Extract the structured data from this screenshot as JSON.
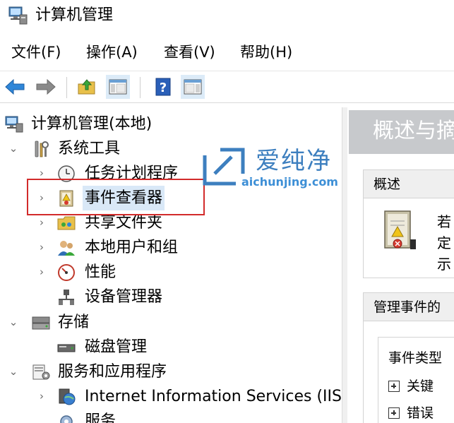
{
  "window": {
    "title": "计算机管理"
  },
  "menu": [
    {
      "label": "文件(F)"
    },
    {
      "label": "操作(A)"
    },
    {
      "label": "查看(V)"
    },
    {
      "label": "帮助(H)"
    }
  ],
  "toolbar": {
    "icons": [
      "back-arrow-icon",
      "forward-arrow-icon",
      "up-folder-icon",
      "show-hide-tree-icon",
      "help-icon",
      "show-hide-action-pane-icon"
    ]
  },
  "tree": {
    "root": "计算机管理(本地)",
    "system_tools": "系统工具",
    "task_scheduler": "任务计划程序",
    "event_viewer": "事件查看器",
    "shared_folders": "共享文件夹",
    "local_users": "本地用户和组",
    "performance": "性能",
    "device_manager": "设备管理器",
    "storage": "存储",
    "disk_management": "磁盘管理",
    "services_apps": "服务和应用程序",
    "iis": "Internet Information Services (IIS)管",
    "services": "服务"
  },
  "watermark": {
    "title": "爱纯净",
    "url": "aichunjing.com"
  },
  "right_pane": {
    "header": "概述与摘",
    "overview_section": "概述",
    "overview_text": [
      "若",
      "定",
      "示"
    ],
    "manage_section": "管理事件的",
    "event_type_label": "事件类型",
    "rows": [
      "关键",
      "错误"
    ]
  },
  "colors": {
    "highlight_box": "#d22b2b",
    "watermark": "#3d7fbf",
    "header_bg": "#c7c9cc"
  }
}
